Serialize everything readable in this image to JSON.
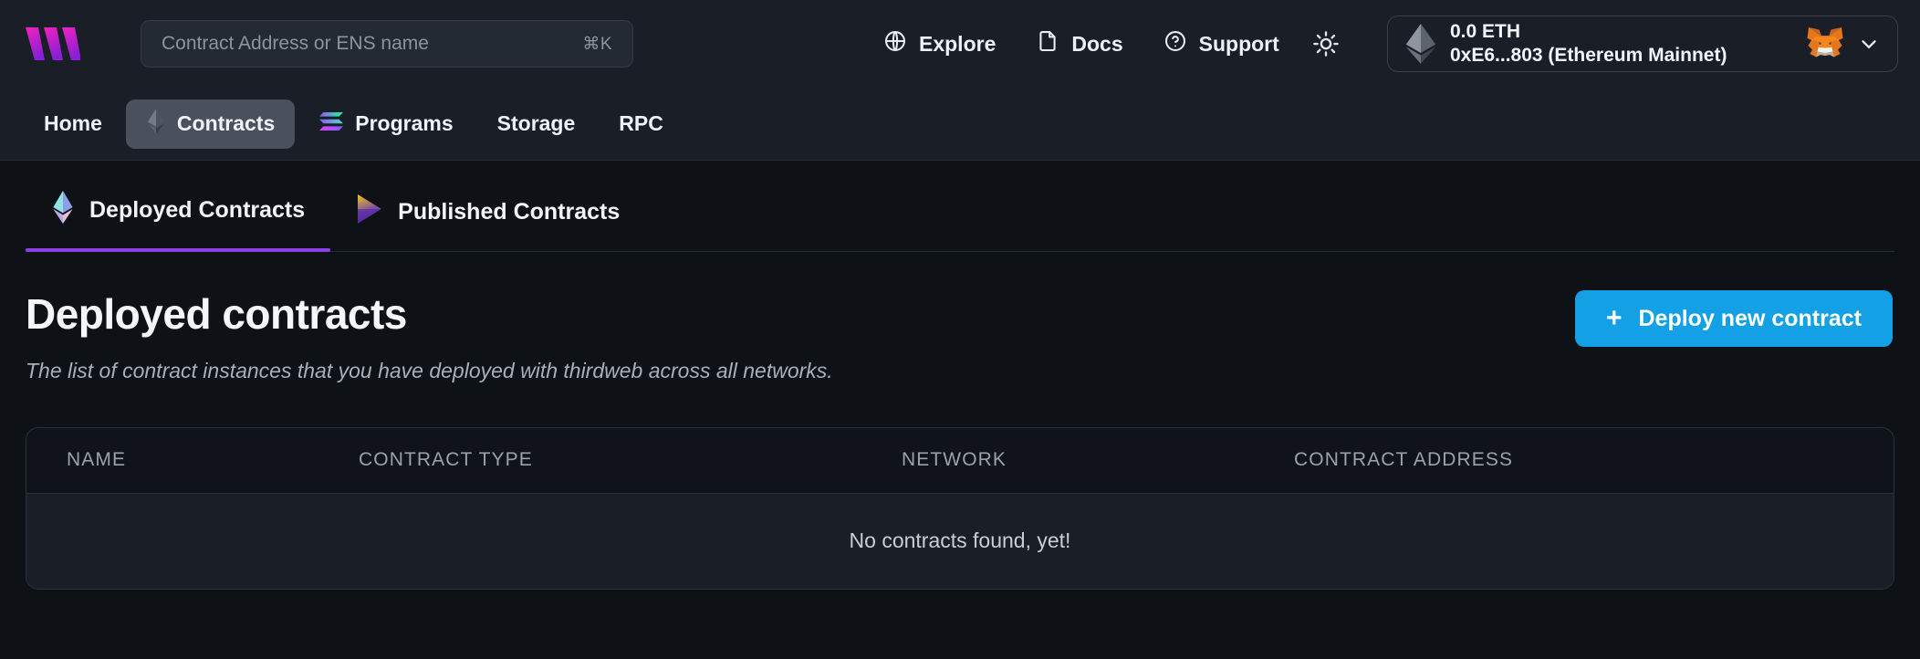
{
  "brand": {
    "logo_name": "thirdweb-logo",
    "colors": {
      "accent_purple": "#8b3fe8",
      "button_blue": "#14a0e4",
      "logo_pink": "#e832c8",
      "logo_purple": "#8b1fd6"
    }
  },
  "search": {
    "placeholder": "Contract Address or ENS name",
    "value": "",
    "shortcut": "⌘K"
  },
  "topnav": {
    "items": [
      {
        "label": "Explore",
        "icon": "globe-icon"
      },
      {
        "label": "Docs",
        "icon": "document-icon"
      },
      {
        "label": "Support",
        "icon": "question-circle-icon"
      }
    ],
    "theme_toggle_icon": "sun-icon"
  },
  "wallet": {
    "balance": "0.0 ETH",
    "address_network": "0xE6...803 (Ethereum Mainnet)",
    "chain_icon": "ethereum-icon",
    "wallet_icon": "metamask-fox-icon",
    "chevron_icon": "chevron-down-icon"
  },
  "subnav": {
    "items": [
      {
        "label": "Home",
        "icon": null,
        "active": false
      },
      {
        "label": "Contracts",
        "icon": "ethereum-icon",
        "active": true
      },
      {
        "label": "Programs",
        "icon": "solana-icon",
        "active": false
      },
      {
        "label": "Storage",
        "icon": null,
        "active": false
      },
      {
        "label": "RPC",
        "icon": null,
        "active": false
      }
    ]
  },
  "tabs": [
    {
      "label": "Deployed Contracts",
      "icon": "ethereum-colored-icon",
      "active": true
    },
    {
      "label": "Published Contracts",
      "icon": "thirdweb-publish-icon",
      "active": false
    }
  ],
  "page": {
    "title": "Deployed contracts",
    "subtitle": "The list of contract instances that you have deployed with thirdweb across all networks.",
    "deploy_button": {
      "label": "Deploy new contract",
      "icon": "plus-icon"
    }
  },
  "table": {
    "columns": [
      "NAME",
      "CONTRACT TYPE",
      "NETWORK",
      "CONTRACT ADDRESS"
    ],
    "rows": [],
    "empty_message": "No contracts found, yet!"
  }
}
